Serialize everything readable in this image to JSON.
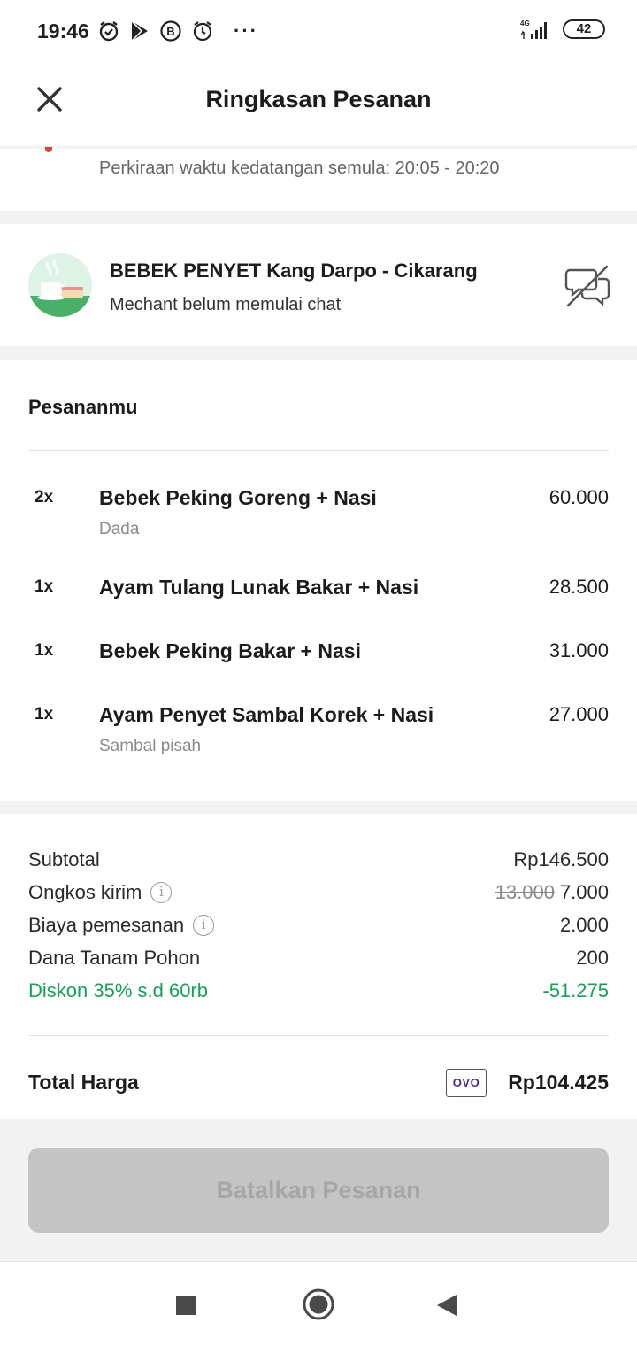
{
  "status_bar": {
    "time": "19:46",
    "network": "4G",
    "battery": "42",
    "more": "···"
  },
  "header": {
    "title": "Ringkasan Pesanan",
    "close_icon": "close-icon"
  },
  "eta": {
    "text": "Perkiraan waktu kedatangan semula: 20:05 - 20:20"
  },
  "merchant": {
    "name": "BEBEK PENYET Kang Darpo - Cikarang",
    "status": "Mechant belum memulai chat",
    "chat_icon": "chat-disabled-icon"
  },
  "orders": {
    "title": "Pesananmu",
    "items": [
      {
        "qty": "2x",
        "name": "Bebek Peking Goreng + Nasi",
        "note": "Dada",
        "price": "60.000"
      },
      {
        "qty": "1x",
        "name": "Ayam Tulang Lunak Bakar + Nasi",
        "note": "",
        "price": "28.500"
      },
      {
        "qty": "1x",
        "name": "Bebek Peking Bakar + Nasi",
        "note": "",
        "price": "31.000"
      },
      {
        "qty": "1x",
        "name": "Ayam Penyet Sambal Korek + Nasi",
        "note": "Sambal pisah",
        "price": "27.000"
      }
    ]
  },
  "summary": {
    "subtotal_label": "Subtotal",
    "subtotal_value": "Rp146.500",
    "delivery_label": "Ongkos kirim",
    "delivery_old": "13.000",
    "delivery_value": "7.000",
    "service_label": "Biaya pemesanan",
    "service_value": "2.000",
    "tree_label": "Dana Tanam Pohon",
    "tree_value": "200",
    "discount_label": "Diskon 35% s.d 60rb",
    "discount_value": "-51.275",
    "total_label": "Total Harga",
    "payment_method": "OVO",
    "total_value": "Rp104.425",
    "info_glyph": "i"
  },
  "actions": {
    "cancel_label": "Batalkan Pesanan"
  },
  "colors": {
    "discount": "#18a157",
    "disabled_button": "#c4c4c4",
    "section_gap": "#f2f2f2"
  }
}
